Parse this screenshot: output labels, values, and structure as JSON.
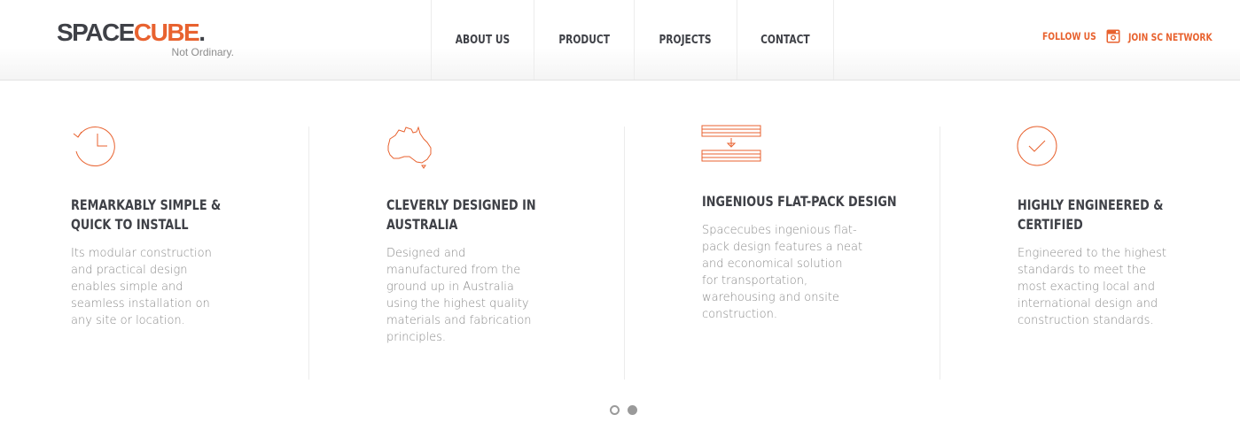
{
  "header": {
    "logo": {
      "word_part1": "SPACE",
      "word_part2": "CUBE",
      "dot": ".",
      "tagline": "Not Ordinary."
    },
    "nav": [
      {
        "label": "ABOUT US"
      },
      {
        "label": "PRODUCT"
      },
      {
        "label": "PROJECTS"
      },
      {
        "label": "CONTACT"
      }
    ],
    "follow_label": "FOLLOW US",
    "join_label": "JOIN SC NETWORK"
  },
  "features": [
    {
      "icon": "clock-icon",
      "title_line1": "REMARKABLY SIMPLE &",
      "title_line2": "QUICK TO INSTALL",
      "desc": [
        "Its modular construction",
        "and practical design",
        "enables simple and",
        "seamless installation on",
        "any site or location."
      ]
    },
    {
      "icon": "australia-map-icon",
      "title_line1": "CLEVERLY DESIGNED IN",
      "title_line2": "AUSTRALIA",
      "desc": [
        "Designed and",
        "manufactured from the",
        "ground up in Australia",
        "using the highest quality",
        "materials and fabrication",
        "principles."
      ]
    },
    {
      "icon": "flat-pack-icon",
      "title_line1": "INGENIOUS FLAT-PACK DESIGN",
      "title_line2": "",
      "desc": [
        "Spacecubes ingenious flat-",
        "pack design features a neat",
        "and economical solution",
        "for transportation,",
        "warehousing and onsite",
        "construction."
      ]
    },
    {
      "icon": "checkmark-circle-icon",
      "title_line1": "HIGHLY ENGINEERED &",
      "title_line2": "CERTIFIED",
      "desc": [
        "Engineered to the highest",
        "standards to meet the",
        "most exacting local and",
        "international design and",
        "construction standards."
      ]
    }
  ],
  "carousel": {
    "active_index": 1,
    "count": 2
  },
  "colors": {
    "accent": "#e8622f",
    "dark": "#3f4147",
    "text": "#8a8a8a"
  }
}
